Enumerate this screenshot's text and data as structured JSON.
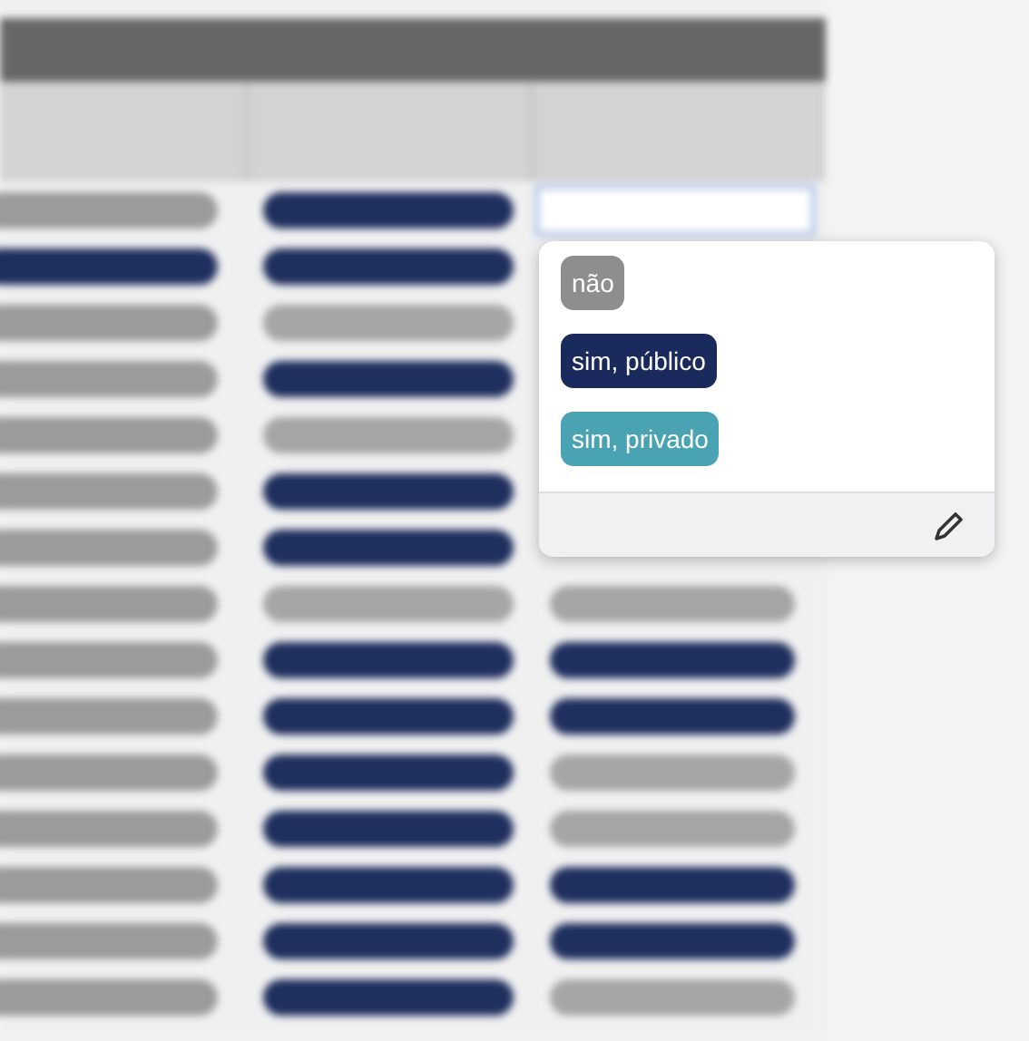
{
  "table": {
    "rows": [
      {
        "cells": [
          {
            "kind": "pill",
            "color": "#9b9b9b"
          },
          {
            "kind": "pill",
            "color": "#1f2f5e"
          },
          {
            "kind": "field"
          }
        ]
      },
      {
        "cells": [
          {
            "kind": "pill",
            "color": "#1f2f5e"
          },
          {
            "kind": "pill",
            "color": "#1f2f5e"
          },
          null
        ]
      },
      {
        "cells": [
          {
            "kind": "pill",
            "color": "#9b9b9b"
          },
          {
            "kind": "pill",
            "color": "#a5a5a5"
          },
          null
        ]
      },
      {
        "cells": [
          {
            "kind": "pill",
            "color": "#9b9b9b"
          },
          {
            "kind": "pill",
            "color": "#1f2f5e"
          },
          null
        ]
      },
      {
        "cells": [
          {
            "kind": "pill",
            "color": "#9b9b9b"
          },
          {
            "kind": "pill",
            "color": "#a5a5a5"
          },
          null
        ]
      },
      {
        "cells": [
          {
            "kind": "pill",
            "color": "#9b9b9b"
          },
          {
            "kind": "pill",
            "color": "#1f2f5e"
          },
          null
        ]
      },
      {
        "cells": [
          {
            "kind": "pill",
            "color": "#9b9b9b"
          },
          {
            "kind": "pill",
            "color": "#1f2f5e"
          },
          null
        ]
      },
      {
        "cells": [
          {
            "kind": "pill",
            "color": "#9b9b9b"
          },
          {
            "kind": "pill",
            "color": "#a5a5a5"
          },
          {
            "kind": "pill",
            "color": "#a5a5a5"
          }
        ]
      },
      {
        "cells": [
          {
            "kind": "pill",
            "color": "#9b9b9b"
          },
          {
            "kind": "pill",
            "color": "#1f2f5e"
          },
          {
            "kind": "pill",
            "color": "#1f2f5e"
          }
        ]
      },
      {
        "cells": [
          {
            "kind": "pill",
            "color": "#9b9b9b"
          },
          {
            "kind": "pill",
            "color": "#1f2f5e"
          },
          {
            "kind": "pill",
            "color": "#1f2f5e"
          }
        ]
      },
      {
        "cells": [
          {
            "kind": "pill",
            "color": "#9b9b9b"
          },
          {
            "kind": "pill",
            "color": "#1f2f5e"
          },
          {
            "kind": "pill",
            "color": "#a5a5a5"
          }
        ]
      },
      {
        "cells": [
          {
            "kind": "pill",
            "color": "#9b9b9b"
          },
          {
            "kind": "pill",
            "color": "#1f2f5e"
          },
          {
            "kind": "pill",
            "color": "#a5a5a5"
          }
        ]
      },
      {
        "cells": [
          {
            "kind": "pill",
            "color": "#9b9b9b"
          },
          {
            "kind": "pill",
            "color": "#1f2f5e"
          },
          {
            "kind": "pill",
            "color": "#1f2f5e"
          }
        ]
      },
      {
        "cells": [
          {
            "kind": "pill",
            "color": "#9b9b9b"
          },
          {
            "kind": "pill",
            "color": "#1f2f5e"
          },
          {
            "kind": "pill",
            "color": "#1f2f5e"
          }
        ]
      },
      {
        "cells": [
          {
            "kind": "pill",
            "color": "#9b9b9b"
          },
          {
            "kind": "pill",
            "color": "#1f2f5e"
          },
          {
            "kind": "pill",
            "color": "#a5a5a5"
          }
        ]
      }
    ]
  },
  "dropdown": {
    "options": [
      {
        "label": "não",
        "color": "#8e8e8e"
      },
      {
        "label": "sim, público",
        "color": "#1b2a5c"
      },
      {
        "label": "sim, privado",
        "color": "#4aa3b3"
      }
    ]
  }
}
